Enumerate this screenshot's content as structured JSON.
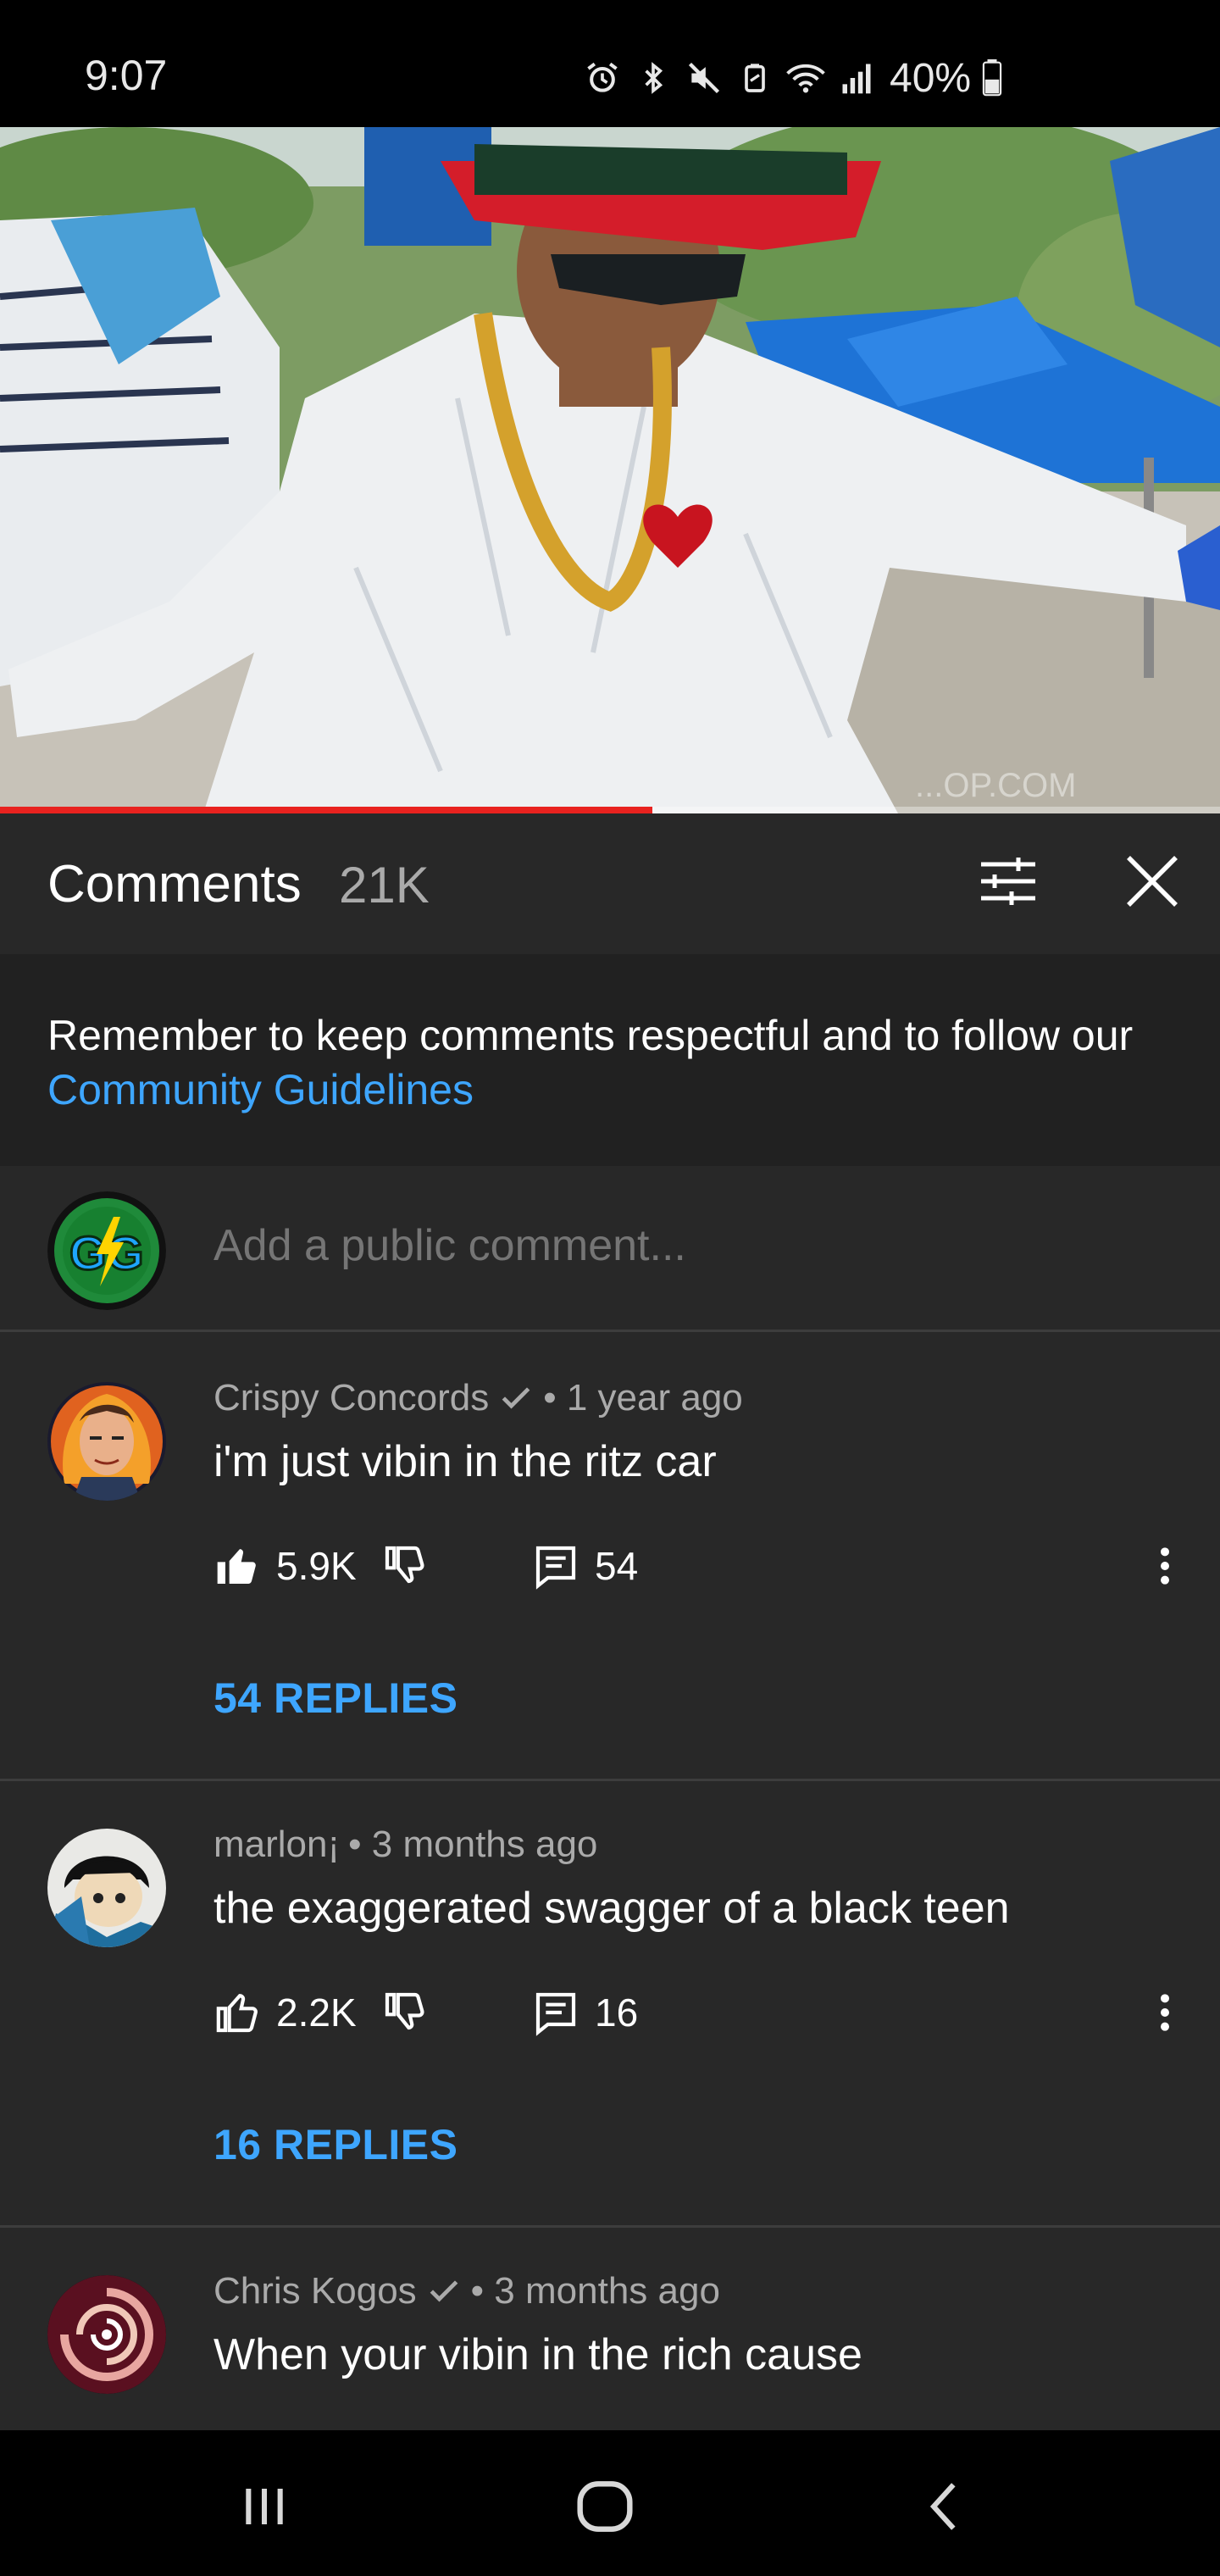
{
  "status_bar": {
    "time": "9:07",
    "battery_text": "40%",
    "icons": [
      "alarm-icon",
      "bluetooth-icon",
      "mute-icon",
      "battery-saver-icon",
      "wifi-icon",
      "signal-icon",
      "battery-icon"
    ]
  },
  "video": {
    "progress_fraction": 0.535,
    "watermark": "...OP.COM"
  },
  "comments_header": {
    "title": "Comments",
    "count": "21K"
  },
  "guidelines": {
    "text": "Remember to keep comments respectful and to follow our ",
    "link": "Community Guidelines"
  },
  "add_comment": {
    "placeholder": "Add a public comment..."
  },
  "comments": [
    {
      "author": "Crispy Concords",
      "verified": true,
      "time": "• 1 year ago",
      "text": "i'm just vibin in the ritz car",
      "likes": "5.9K",
      "liked": true,
      "reply_count": "54",
      "replies_label": "54 REPLIES"
    },
    {
      "author": "marlon¡",
      "verified": false,
      "time": "• 3 months ago",
      "text": "the exaggerated swagger of a black teen",
      "likes": "2.2K",
      "liked": false,
      "reply_count": "16",
      "replies_label": "16 REPLIES"
    },
    {
      "author": "Chris Kogos",
      "verified": true,
      "time": "• 3 months ago",
      "text": "When your vibin in the rich cause"
    }
  ],
  "colors": {
    "background": "#282828",
    "accent_link": "#3ea6ff",
    "progress": "#e8221f"
  }
}
